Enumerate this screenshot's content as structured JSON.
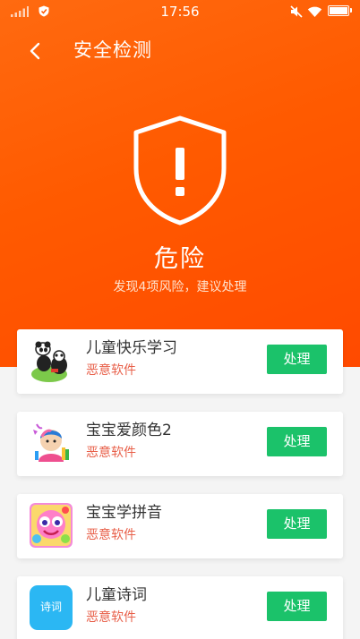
{
  "status_bar": {
    "time": "17:56"
  },
  "header": {
    "title": "安全检测"
  },
  "result": {
    "status": "危险",
    "summary": "发现4项风险，建议处理"
  },
  "apps": [
    {
      "name": "儿童快乐学习",
      "tag": "恶意软件",
      "action": "处理",
      "icon": "panda-app-icon"
    },
    {
      "name": "宝宝爱颜色2",
      "tag": "恶意软件",
      "action": "处理",
      "icon": "coloring-app-icon"
    },
    {
      "name": "宝宝学拼音",
      "tag": "恶意软件",
      "action": "处理",
      "icon": "pinyin-app-icon"
    },
    {
      "name": "儿童诗词",
      "tag": "恶意软件",
      "action": "处理",
      "icon": "poem-app-icon",
      "icon_text": "诗词"
    }
  ],
  "colors": {
    "hero_orange": "#ff5a00",
    "action_green": "#1bc26a",
    "tag_red": "#e8604a",
    "poem_icon_blue": "#2bb7f3"
  }
}
